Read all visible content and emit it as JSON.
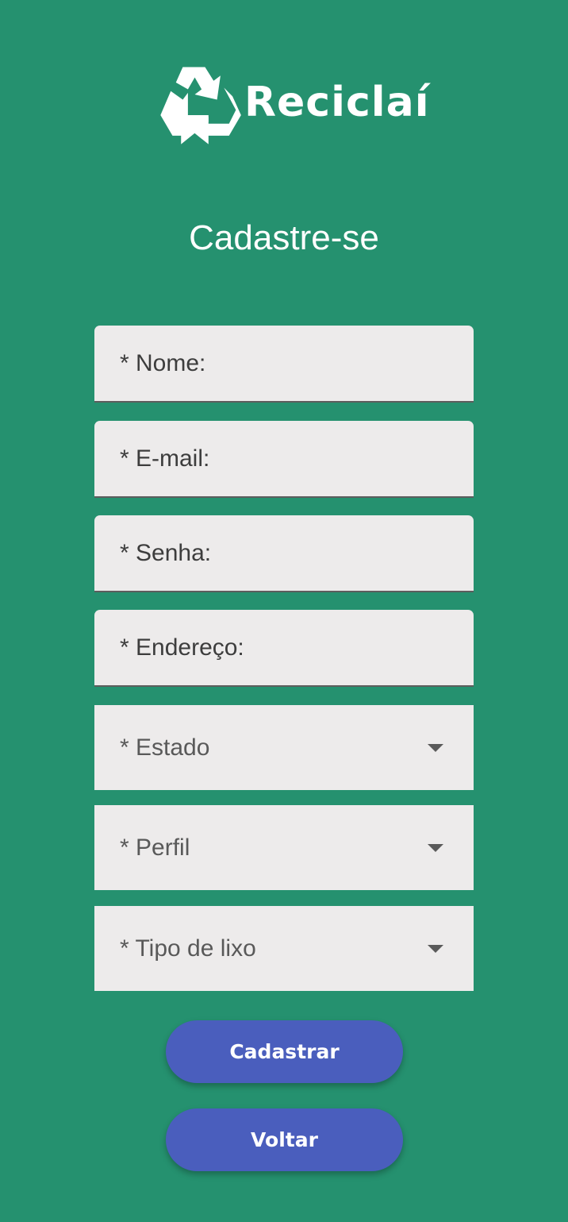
{
  "app": {
    "logo_text": "Reciclaí",
    "logo_icon": "recycle-icon"
  },
  "page": {
    "title": "Cadastre-se"
  },
  "form": {
    "name_label": "* Nome:",
    "email_label": "* E-mail:",
    "password_label": "* Senha:",
    "address_label": "* Endereço:",
    "state_select": "* Estado",
    "profile_select": "* Perfil",
    "waste_type_select": "* Tipo de lixo"
  },
  "actions": {
    "submit_label": "Cadastrar",
    "back_label": "Voltar"
  },
  "colors": {
    "background": "#25916f",
    "field_background": "#edebeb",
    "button": "#4a5ebd",
    "text_light": "#ffffff"
  }
}
